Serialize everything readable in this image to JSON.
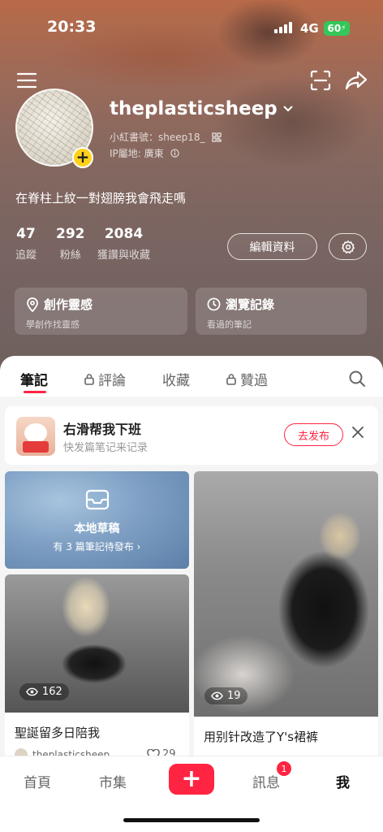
{
  "status_bar": {
    "time": "20:33",
    "network": "4G",
    "battery": "60"
  },
  "profile": {
    "username": "theplasticsheep",
    "red_id": "小紅書號：sheep18_",
    "ip_location": "IP屬地: 廣東",
    "bio": "在脊柱上紋一對翅膀我會飛走嗎",
    "stats": [
      {
        "value": "47",
        "label": "追蹤"
      },
      {
        "value": "292",
        "label": "粉絲"
      },
      {
        "value": "2084",
        "label": "獲讚與收藏"
      }
    ],
    "edit_label": "編輯資料"
  },
  "cards": [
    {
      "title": "創作靈感",
      "subtitle": "學創作找靈感"
    },
    {
      "title": "瀏覽記錄",
      "subtitle": "看過的筆記"
    }
  ],
  "tabs": [
    {
      "label": "筆記",
      "active": true,
      "locked": false
    },
    {
      "label": "評論",
      "active": false,
      "locked": true
    },
    {
      "label": "收藏",
      "active": false,
      "locked": false
    },
    {
      "label": "贊過",
      "active": false,
      "locked": true
    }
  ],
  "promo": {
    "title": "右滑帮我下班",
    "subtitle": "快发篇笔记来记录",
    "button": "去发布"
  },
  "draft": {
    "title": "本地草稿",
    "subtitle": "有 3 篇筆記待發布 ›"
  },
  "posts": [
    {
      "title": "聖誕留多日陪我",
      "views": "162",
      "author": "theplasticsheep",
      "likes": "29"
    },
    {
      "title": "用别针改造了Y's裙裤",
      "views": "19"
    }
  ],
  "bottom_nav": {
    "items": [
      "首頁",
      "市集",
      "訊息",
      "我"
    ],
    "message_badge": "1",
    "active": "我"
  },
  "colors": {
    "accent": "#ff2442",
    "avatar_plus": "#ffd11a",
    "battery": "#34c759"
  }
}
